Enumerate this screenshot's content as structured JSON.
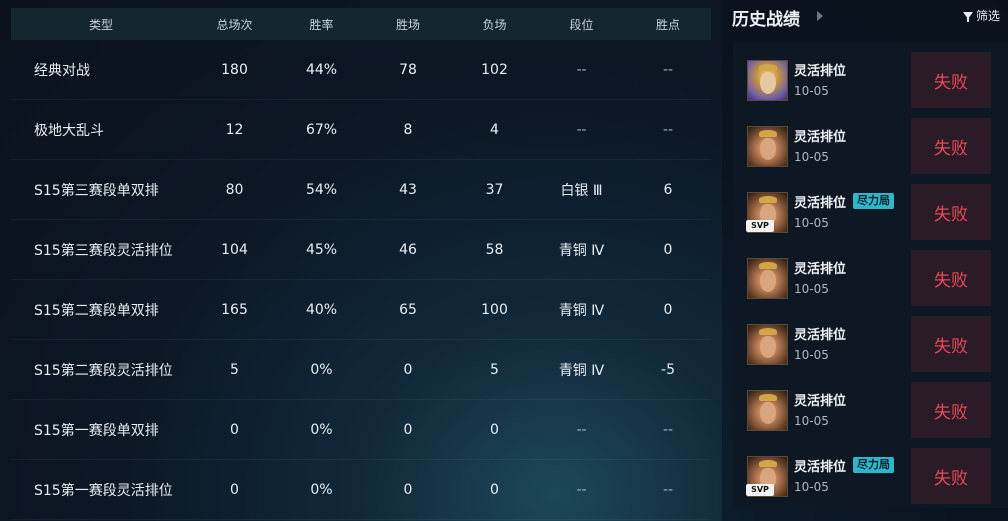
{
  "table": {
    "headers": [
      "类型",
      "总场次",
      "胜率",
      "胜场",
      "负场",
      "段位",
      "胜点"
    ],
    "rows": [
      [
        "经典对战",
        "180",
        "44%",
        "78",
        "102",
        "--",
        "--"
      ],
      [
        "极地大乱斗",
        "12",
        "67%",
        "8",
        "4",
        "--",
        "--"
      ],
      [
        "S15第三赛段单双排",
        "80",
        "54%",
        "43",
        "37",
        "白银 Ⅲ",
        "6"
      ],
      [
        "S15第三赛段灵活排位",
        "104",
        "45%",
        "46",
        "58",
        "青铜 Ⅳ",
        "0"
      ],
      [
        "S15第二赛段单双排",
        "165",
        "40%",
        "65",
        "100",
        "青铜 Ⅳ",
        "0"
      ],
      [
        "S15第二赛段灵活排位",
        "5",
        "0%",
        "0",
        "5",
        "青铜 Ⅳ",
        "-5"
      ],
      [
        "S15第一赛段单双排",
        "0",
        "0%",
        "0",
        "0",
        "--",
        "--"
      ],
      [
        "S15第一赛段灵活排位",
        "0",
        "0%",
        "0",
        "0",
        "--",
        "--"
      ]
    ]
  },
  "history": {
    "title": "历史战绩",
    "filter_label": "筛选",
    "matches": [
      {
        "mode": "灵活排位",
        "date": "10-05",
        "result": "失败",
        "tag": "",
        "badge": "",
        "avatar": "champion-portrait-blond"
      },
      {
        "mode": "灵活排位",
        "date": "10-05",
        "result": "失败",
        "tag": "",
        "badge": "",
        "avatar": "champion-portrait-brown"
      },
      {
        "mode": "灵活排位",
        "date": "10-05",
        "result": "失败",
        "tag": "尽力局",
        "badge": "SVP",
        "avatar": "champion-portrait-brown"
      },
      {
        "mode": "灵活排位",
        "date": "10-05",
        "result": "失败",
        "tag": "",
        "badge": "",
        "avatar": "champion-portrait-brown"
      },
      {
        "mode": "灵活排位",
        "date": "10-05",
        "result": "失败",
        "tag": "",
        "badge": "",
        "avatar": "champion-portrait-brown"
      },
      {
        "mode": "灵活排位",
        "date": "10-05",
        "result": "失败",
        "tag": "",
        "badge": "",
        "avatar": "champion-portrait-brown"
      },
      {
        "mode": "灵活排位",
        "date": "10-05",
        "result": "失败",
        "tag": "尽力局",
        "badge": "SVP",
        "avatar": "champion-portrait-brown"
      }
    ]
  },
  "colors": {
    "loss_text": "#e8485b",
    "loss_bg": "#2a1b26",
    "tag_bg": "#2fb7c9",
    "header_bg": "#142630"
  }
}
